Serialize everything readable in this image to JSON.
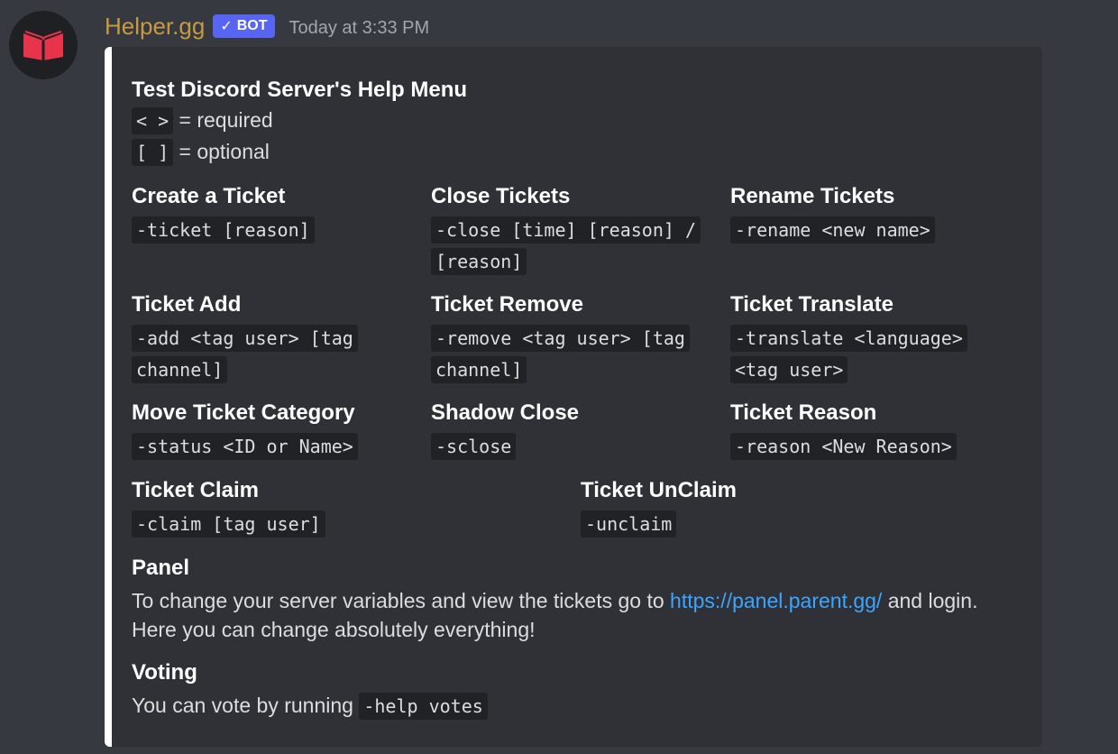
{
  "message": {
    "username": "Helper.gg",
    "bot_tag": "BOT",
    "bot_check": "✓",
    "timestamp": "Today at 3:33 PM",
    "username_color": "#c69a40",
    "avatar_icon": "book-logo-icon"
  },
  "embed": {
    "accent_color": "#ffffff",
    "title": "Test Discord Server's Help Menu",
    "legend": [
      {
        "code": "< >",
        "text": " = required"
      },
      {
        "code": "[ ]",
        "text": " = optional"
      }
    ],
    "fields": [
      {
        "name": "Create a Ticket",
        "value": "-ticket [reason]"
      },
      {
        "name": "Close Tickets",
        "value": "-close [time] [reason] / [reason]"
      },
      {
        "name": "Rename Tickets",
        "value": "-rename <new name>"
      },
      {
        "name": "Ticket Add",
        "value": "-add <tag user> [tag channel]"
      },
      {
        "name": "Ticket Remove",
        "value": "-remove <tag user> [tag channel]"
      },
      {
        "name": "Ticket Translate",
        "value": "-translate <language> <tag user>"
      },
      {
        "name": "Move Ticket Category",
        "value": "-status <ID or Name>"
      },
      {
        "name": "Shadow Close",
        "value": "-sclose"
      },
      {
        "name": "Ticket Reason",
        "value": "-reason <New Reason>"
      },
      {
        "name": "Ticket Claim",
        "value": "-claim [tag user]"
      },
      {
        "name": "Ticket UnClaim",
        "value": "-unclaim"
      }
    ],
    "panel": {
      "name": "Panel",
      "text_before": "To change your server variables and view the tickets go to ",
      "link": "https://panel.parent.gg/",
      "text_after": " and login. Here you can change absolutely everything!"
    },
    "voting": {
      "name": "Voting",
      "text": "You can vote by running ",
      "code": "-help votes"
    }
  }
}
